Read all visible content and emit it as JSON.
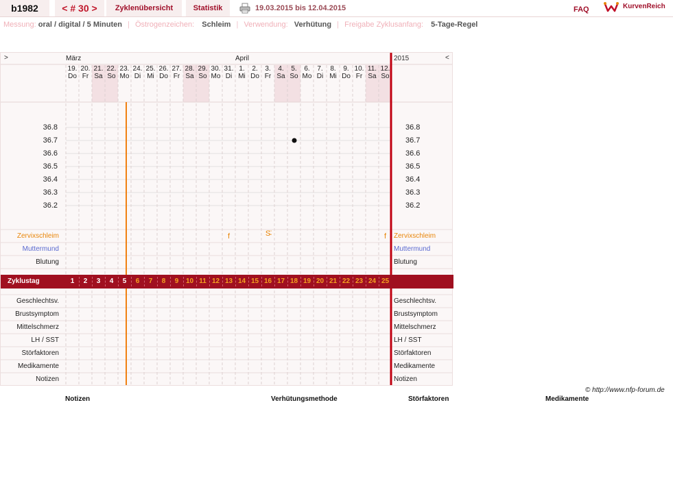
{
  "header": {
    "user": "b1982",
    "cycle": "< # 30 >",
    "overview": "Zyklenübersicht",
    "stats": "Statistik",
    "daterange": "19.03.2015 bis 12.04.2015",
    "faq": "FAQ",
    "brand": "KurvenReich"
  },
  "meta": {
    "measure_label": "Messung:",
    "measure_value": "oral / digital / 5 Minuten",
    "estrogen_label": "Östrogenzeichen:",
    "estrogen_value": "Schleim",
    "use_label": "Verwendung:",
    "use_value": "Verhütung",
    "release_label": "Freigabe Zyklusanfang:",
    "release_value": "5-Tage-Regel",
    "sep": "|"
  },
  "chart": {
    "nav_left": ">",
    "nav_right": "<",
    "year": "2015",
    "months": [
      {
        "label": "März",
        "col": 0
      },
      {
        "label": "April",
        "col": 13
      }
    ],
    "days": [
      {
        "num": "19.",
        "wd": "Do",
        "we": false
      },
      {
        "num": "20.",
        "wd": "Fr",
        "we": false
      },
      {
        "num": "21.",
        "wd": "Sa",
        "we": true
      },
      {
        "num": "22.",
        "wd": "So",
        "we": true
      },
      {
        "num": "23.",
        "wd": "Mo",
        "we": false
      },
      {
        "num": "24.",
        "wd": "Di",
        "we": false
      },
      {
        "num": "25.",
        "wd": "Mi",
        "we": false
      },
      {
        "num": "26.",
        "wd": "Do",
        "we": false
      },
      {
        "num": "27.",
        "wd": "Fr",
        "we": false
      },
      {
        "num": "28.",
        "wd": "Sa",
        "we": true
      },
      {
        "num": "29.",
        "wd": "So",
        "we": true
      },
      {
        "num": "30.",
        "wd": "Mo",
        "we": false
      },
      {
        "num": "31.",
        "wd": "Di",
        "we": false
      },
      {
        "num": "1.",
        "wd": "Mi",
        "we": false
      },
      {
        "num": "2.",
        "wd": "Do",
        "we": false
      },
      {
        "num": "3.",
        "wd": "Fr",
        "we": false
      },
      {
        "num": "4.",
        "wd": "Sa",
        "we": true
      },
      {
        "num": "5.",
        "wd": "So",
        "we": true
      },
      {
        "num": "6.",
        "wd": "Mo",
        "we": false
      },
      {
        "num": "7.",
        "wd": "Di",
        "we": false
      },
      {
        "num": "8.",
        "wd": "Mi",
        "we": false
      },
      {
        "num": "9.",
        "wd": "Do",
        "we": false
      },
      {
        "num": "10.",
        "wd": "Fr",
        "we": false
      },
      {
        "num": "11.",
        "wd": "Sa",
        "we": true
      },
      {
        "num": "12.",
        "wd": "So",
        "we": true
      }
    ],
    "temps": [
      "36.8",
      "36.7",
      "36.6",
      "36.5",
      "36.4",
      "36.3",
      "36.2"
    ],
    "temp_points": [
      {
        "day": 17,
        "temp": 36.7
      }
    ],
    "mucus_marks": [
      {
        "day": 12,
        "sym": "f"
      },
      {
        "day": 15,
        "sym": "S̵̈"
      },
      {
        "day": 24,
        "sym": "f"
      }
    ],
    "rows_top": [
      {
        "label": "Zervixschleim",
        "color": "#e8860a"
      },
      {
        "label": "Muttermund",
        "color": "#5a6ad0"
      },
      {
        "label": "Blutung",
        "color": "#222222"
      }
    ],
    "zyklustag_label": "Zyklustag",
    "cycle_days": [
      "1",
      "2",
      "3",
      "4",
      "5",
      "6",
      "7",
      "8",
      "9",
      "10",
      "11",
      "12",
      "13",
      "14",
      "15",
      "16",
      "17",
      "18",
      "19",
      "20",
      "21",
      "22",
      "23",
      "24",
      "25"
    ],
    "rows_bottom": [
      "Geschlechtsv.",
      "Brustsymptom",
      "Mittelschmerz",
      "LH / SST",
      "Störfaktoren",
      "Medikamente",
      "Notizen"
    ]
  },
  "footer": {
    "copyright": "© http://www.nfp-forum.de",
    "notes": "Notizen",
    "method": "Verhütungsmethode",
    "disturb": "Störfaktoren",
    "meds": "Medikamente"
  },
  "colors": {
    "accent": "#a01020",
    "ovulation_line": "#f08010",
    "cycle_end_line": "#c00010"
  }
}
